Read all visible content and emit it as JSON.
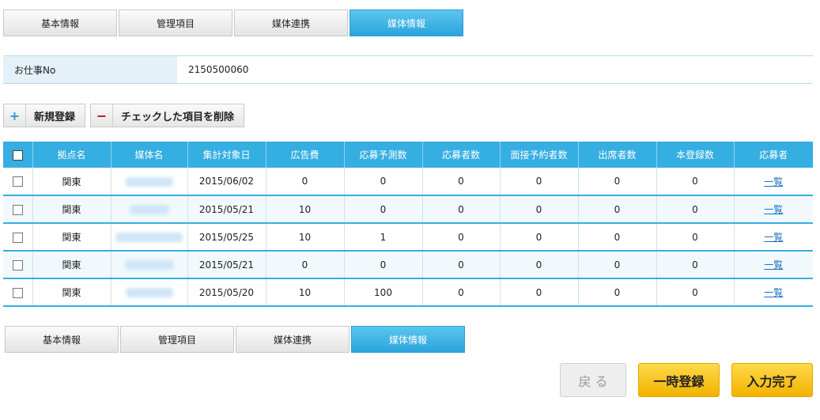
{
  "tabs": [
    "基本情報",
    "管理項目",
    "媒体連携",
    "媒体情報"
  ],
  "info": {
    "label": "お仕事No",
    "value": "2150500060"
  },
  "actions": {
    "new_label": "新規登録",
    "delete_label": "チェックした項目を削除"
  },
  "table": {
    "headers": [
      "拠点名",
      "媒体名",
      "集計対象日",
      "広告費",
      "応募予測数",
      "応募者数",
      "面接予約者数",
      "出席者数",
      "本登録数",
      "応募者"
    ],
    "rows": [
      {
        "base": "関東",
        "date": "2015/06/02",
        "ad": "0",
        "forecast": "0",
        "applicants": "0",
        "interview": "0",
        "attend": "0",
        "reg": "0",
        "link": "一覧"
      },
      {
        "base": "関東",
        "date": "2015/05/21",
        "ad": "10",
        "forecast": "0",
        "applicants": "0",
        "interview": "0",
        "attend": "0",
        "reg": "0",
        "link": "一覧"
      },
      {
        "base": "関東",
        "date": "2015/05/25",
        "ad": "10",
        "forecast": "1",
        "applicants": "0",
        "interview": "0",
        "attend": "0",
        "reg": "0",
        "link": "一覧"
      },
      {
        "base": "関東",
        "date": "2015/05/21",
        "ad": "0",
        "forecast": "0",
        "applicants": "0",
        "interview": "0",
        "attend": "0",
        "reg": "0",
        "link": "一覧"
      },
      {
        "base": "関東",
        "date": "2015/05/20",
        "ad": "10",
        "forecast": "100",
        "applicants": "0",
        "interview": "0",
        "attend": "0",
        "reg": "0",
        "link": "一覧"
      }
    ]
  },
  "buttons": {
    "back": "戻 る",
    "temp_save": "一時登録",
    "complete": "入力完了"
  },
  "colors": {
    "accent": "#35aee2",
    "button_yellow": "#f7c31a"
  }
}
